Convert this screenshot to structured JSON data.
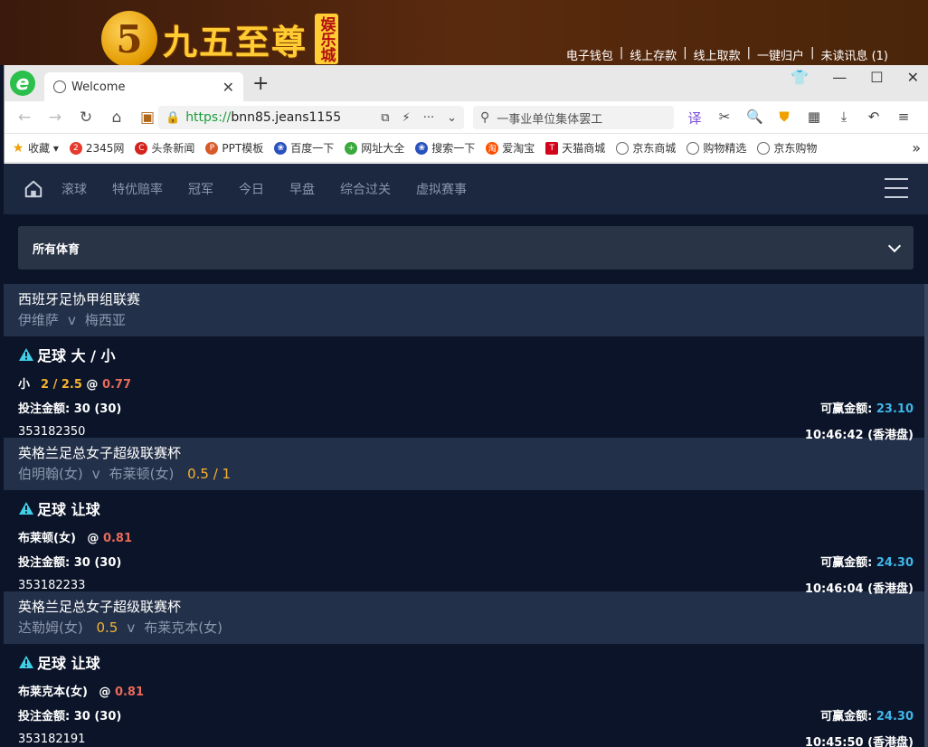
{
  "site": {
    "logo_digit": "5",
    "logo_text": "九五至尊",
    "logo_badge": "娱乐城",
    "links": [
      "电子钱包",
      "线上存款",
      "线上取款",
      "一键归户",
      "未读讯息 (1)"
    ]
  },
  "browser": {
    "tab_title": "Welcome",
    "url_proto": "https://",
    "url_host": "bnn85.jeans1155",
    "search_text": "一事业单位集体罢工",
    "bookmarks": [
      "收藏",
      "2345网",
      "头条新闻",
      "PPT模板",
      "百度一下",
      "网址大全",
      "搜索一下",
      "爱淘宝",
      "天猫商城",
      "京东商城",
      "购物精选",
      "京东购物"
    ]
  },
  "nav": {
    "items": [
      "滚球",
      "特优赔率",
      "冠军",
      "今日",
      "早盘",
      "综合过关",
      "虚拟赛事"
    ]
  },
  "filter": {
    "label": "所有体育"
  },
  "labels": {
    "stake": "投注金额:",
    "win": "可赢金额:",
    "at": "@",
    "vs": "v"
  },
  "bets": [
    {
      "league": "西班牙足协甲组联赛",
      "home": "伊维萨",
      "away": "梅西亚",
      "handicap": "",
      "type": "足球 大 / 小",
      "selection": "小",
      "line": "2 / 2.5",
      "odds": "0.77",
      "stake": "30 (30)",
      "win": "23.10",
      "id": "353182350",
      "time": "10:46:42 (香港盘)"
    },
    {
      "league": "英格兰足总女子超级联赛杯",
      "home": "伯明翰(女)",
      "away": "布莱顿(女)",
      "handicap": "0.5 / 1",
      "type": "足球 让球",
      "selection": "布莱顿(女)",
      "line": "",
      "odds": "0.81",
      "stake": "30 (30)",
      "win": "24.30",
      "id": "353182233",
      "time": "10:46:04 (香港盘)"
    },
    {
      "league": "英格兰足总女子超级联赛杯",
      "home": "达勒姆(女)",
      "away": "布莱克本(女)",
      "handicap": "0.5",
      "type": "足球 让球",
      "selection": "布莱克本(女)",
      "line": "",
      "odds": "0.81",
      "stake": "30 (30)",
      "win": "24.30",
      "id": "353182191",
      "time": "10:45:50 (香港盘)"
    }
  ]
}
